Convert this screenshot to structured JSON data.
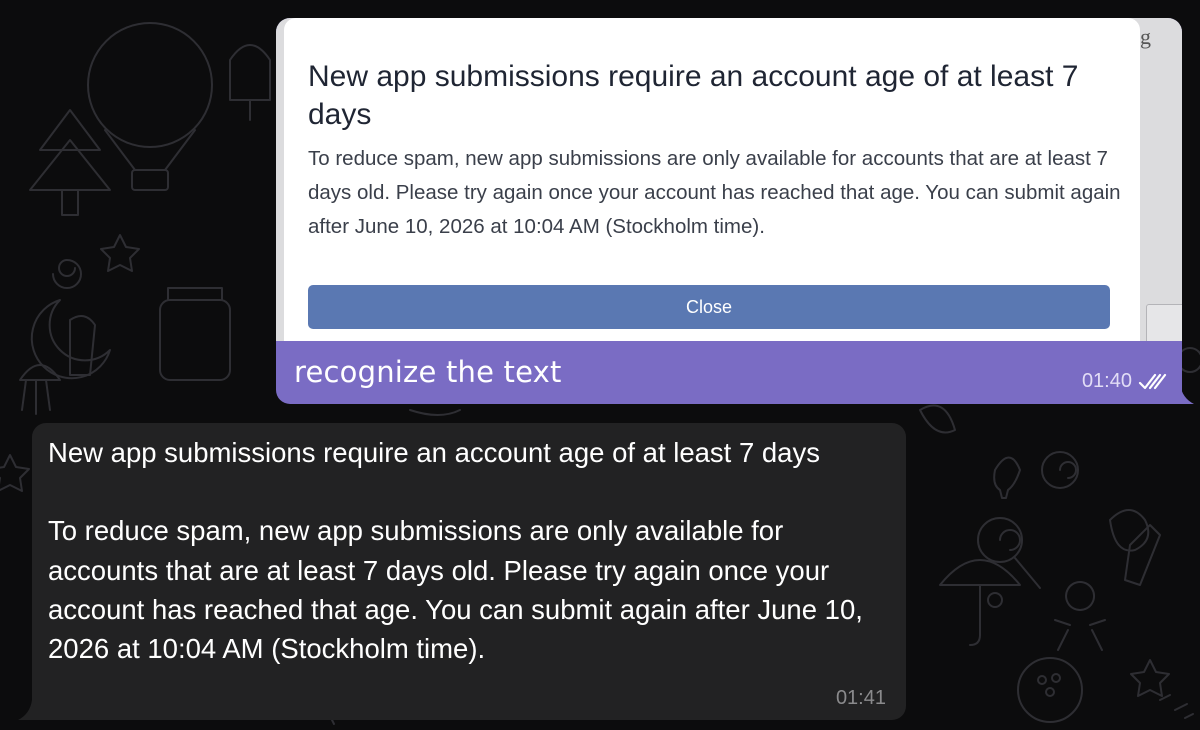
{
  "chat": {
    "outgoing": {
      "photo": {
        "dialog": {
          "title": "New app submissions require an account age of at least 7 days",
          "body": "To reduce spam, new app submissions are only available for accounts that are at least 7 days old. Please try again once your account has reached that age. You can submit again after June 10, 2026 at 10:04 AM (Stockholm time).",
          "close_label": "Close"
        },
        "edge_letter": "g"
      },
      "caption": "recognize the text",
      "time": "01:40",
      "status_icon": "double-check-icon",
      "bubble_color": "#7a6cc4"
    },
    "incoming": {
      "heading": "New app submissions require an account age of at least 7 days",
      "body": "To reduce spam, new app submissions are only available for accounts that are at least 7 days old. Please try again once your account has reached that age. You can submit again after June 10, 2026 at 10:04 AM (Stockholm time).",
      "time": "01:41",
      "bubble_color": "#222223"
    }
  },
  "theme": {
    "background": "#0c0c0d",
    "doodle_color": "#2f2f34",
    "button_color": "#5a78b2"
  }
}
